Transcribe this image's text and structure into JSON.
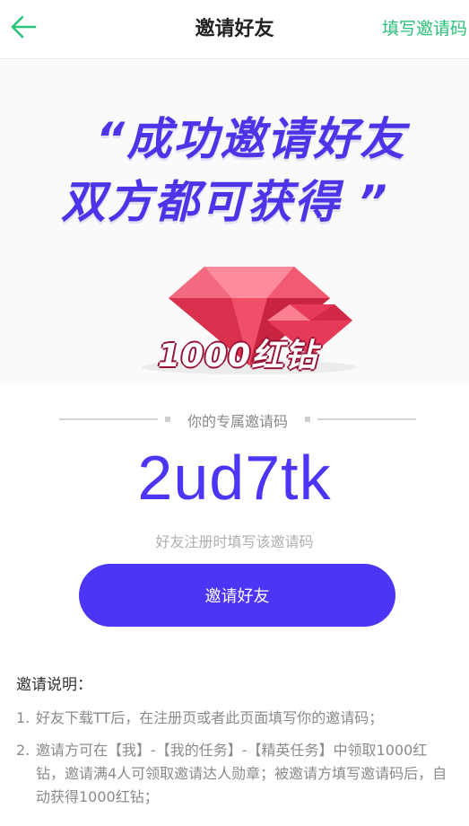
{
  "header": {
    "back_icon": "arrow-left-icon",
    "title": "邀请好友",
    "action_label": "填写邀请码",
    "accent_color": "#2cc27a"
  },
  "banner": {
    "slogan_line1": "“成功邀请好友",
    "slogan_line2": "双方都可获得 ”",
    "reward_label": "1000红钻",
    "gem_icon": "red-diamond-icon"
  },
  "invite_code": {
    "label": "你的专属邀请码",
    "code": "2ud7tk",
    "hint": "好友注册时填写该邀请码",
    "color": "#4c35f5"
  },
  "invite_button": {
    "label": "邀请好友",
    "color": "#4d35f5"
  },
  "instructions": {
    "title": "邀请说明：",
    "items": [
      {
        "num": "1.",
        "text": "好友下载TT后，在注册页或者此页面填写你的邀请码；"
      },
      {
        "num": "2.",
        "text": "邀请方可在【我】-【我的任务】-【精英任务】中领取1000红钻，邀请满4人可领取邀请达人勋章；被邀请方填写邀请码后，自动获得1000红钻；"
      }
    ]
  }
}
